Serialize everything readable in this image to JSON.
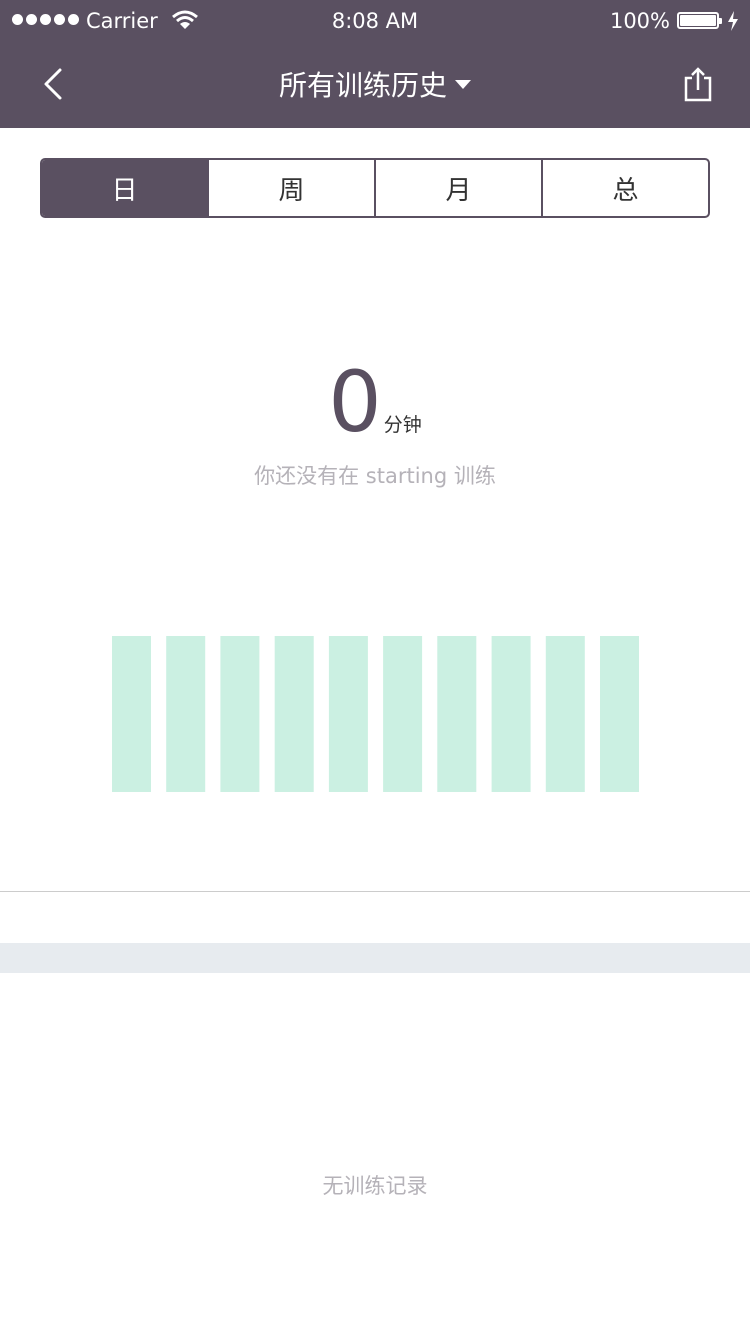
{
  "status_bar": {
    "carrier": "Carrier",
    "time": "8:08 AM",
    "battery": "100%"
  },
  "nav": {
    "title": "所有训练历史",
    "back_icon": "chevron-left-icon",
    "share_icon": "share-icon",
    "dropdown_icon": "caret-down-icon"
  },
  "segments": [
    {
      "label": "日",
      "active": true
    },
    {
      "label": "周",
      "active": false
    },
    {
      "label": "月",
      "active": false
    },
    {
      "label": "总",
      "active": false
    }
  ],
  "summary": {
    "value": "0",
    "unit": "分钟",
    "hint": "你还没有在 starting 训练"
  },
  "chart_data": {
    "type": "bar",
    "values": [
      0,
      0,
      0,
      0,
      0,
      0,
      0,
      0,
      0,
      0
    ],
    "bar_color": "#cbf0e2"
  },
  "records": {
    "empty_text": "无训练记录"
  },
  "colors": {
    "primary": "#5a5061",
    "placeholder_bar": "#cbf0e2",
    "band": "#e7ebef"
  }
}
